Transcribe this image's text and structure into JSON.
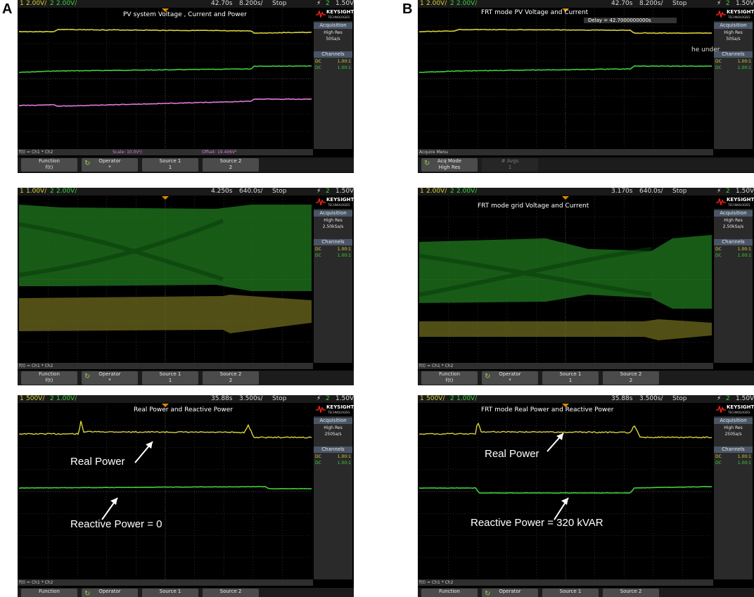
{
  "panel_letters": [
    "A",
    "B"
  ],
  "brand": {
    "name": "KEYSIGHT",
    "sub": "TECHNOLOGIES"
  },
  "acq_heading": "Acquisition",
  "channels_heading": "Channels",
  "scopes": {
    "a1": {
      "topbar": {
        "ch1": "1",
        "ch1_scale": "2.00V/",
        "ch2": "2",
        "ch2_scale": "2.00V/",
        "time": "42.70s",
        "timebase": "8.200s/",
        "run": "Stop",
        "trig_ch": "2",
        "trig_lvl": "1.50V"
      },
      "title": "PV system Voltage , Current and Power",
      "acq_mode": "High Res",
      "acq_rate": "50Sa/s",
      "channels": [
        {
          "coupling": "DC",
          "ratio": "1.00:1"
        },
        {
          "coupling": "DC",
          "ratio": "1.00:1"
        }
      ],
      "status": {
        "expr": "f(t) = Ch1 * Ch2",
        "scale": "Scale: 10.0V²/",
        "offset": "Offset: 19.406V²"
      },
      "softkeys": [
        {
          "label": "Function",
          "value": "f(t)"
        },
        {
          "label": "Operator",
          "value": "*"
        },
        {
          "label": "Source 1",
          "value": "1"
        },
        {
          "label": "Source 2",
          "value": "2"
        }
      ]
    },
    "b1": {
      "topbar": {
        "ch1": "1",
        "ch1_scale": "2.00V/",
        "ch2": "2",
        "ch2_scale": "2.00V/",
        "time": "42.70s",
        "timebase": "8.200s/",
        "run": "Stop",
        "trig_ch": "2",
        "trig_lvl": "1.50V"
      },
      "title": "FRT mode PV Voltage and Current",
      "delay": "Delay = 42.7000000000s",
      "overlay_fragment": "he under",
      "acq_mode": "High Res",
      "acq_rate": "50Sa/s",
      "channels": [
        {
          "coupling": "DC",
          "ratio": "1.00:1"
        },
        {
          "coupling": "DC",
          "ratio": "1.00:1"
        }
      ],
      "status": {
        "menu": "Acquire Menu"
      },
      "softkeys": [
        {
          "label": "Acq Mode",
          "value": "High Res"
        },
        {
          "label": "# Avgs",
          "value": "1"
        }
      ]
    },
    "a2": {
      "topbar": {
        "ch1": "1",
        "ch1_scale": "1.00V/",
        "ch2": "2",
        "ch2_scale": "2.00V/",
        "time": "4.250s",
        "timebase": "640.0s/",
        "run": "Stop",
        "trig_ch": "2",
        "trig_lvl": "1.50V"
      },
      "acq_mode": "High Res",
      "acq_rate": "2.50kSa/s",
      "channels": [
        {
          "coupling": "DC",
          "ratio": "1.00:1"
        },
        {
          "coupling": "DC",
          "ratio": "1.00:1"
        }
      ],
      "status": {
        "expr": "f(t) = Ch1 * Ch2"
      },
      "softkeys": [
        {
          "label": "Function",
          "value": "f(t)"
        },
        {
          "label": "Operator",
          "value": "*"
        },
        {
          "label": "Source 1",
          "value": "1"
        },
        {
          "label": "Source 2",
          "value": "2"
        }
      ]
    },
    "b2": {
      "topbar": {
        "ch1": "1",
        "ch1_scale": "2.00V/",
        "ch2": "2",
        "ch2_scale": "2.00V/",
        "time": "3.170s",
        "timebase": "640.0s/",
        "run": "Stop",
        "trig_ch": "2",
        "trig_lvl": "1.50V"
      },
      "title": "FRT mode grid Voltage and Current",
      "acq_mode": "High Res",
      "acq_rate": "2.50kSa/s",
      "channels": [
        {
          "coupling": "DC",
          "ratio": "1.00:1"
        },
        {
          "coupling": "DC",
          "ratio": "1.00:1"
        }
      ],
      "status": {
        "expr": "f(t) = Ch1 * Ch2"
      },
      "softkeys": [
        {
          "label": "Function",
          "value": "f(t)"
        },
        {
          "label": "Operator",
          "value": "*"
        },
        {
          "label": "Source 1",
          "value": "1"
        },
        {
          "label": "Source 2",
          "value": "2"
        }
      ]
    },
    "a3": {
      "topbar": {
        "ch1": "1",
        "ch1_scale": "500V/",
        "ch2": "2",
        "ch2_scale": "1.00V/",
        "time": "35.88s",
        "timebase": "3.500s/",
        "run": "Stop",
        "trig_ch": "2",
        "trig_lvl": "1.50V"
      },
      "title": "Real Power and Reactive Power",
      "acq_mode": "High Res",
      "acq_rate": "250Sa/s",
      "channels": [
        {
          "coupling": "DC",
          "ratio": "1.00:1"
        },
        {
          "coupling": "DC",
          "ratio": "1.00:1"
        }
      ],
      "annot_real": "Real Power",
      "annot_reactive": "Reactive Power = 0",
      "status": {
        "expr": "f(t) = Ch1 * Ch2"
      },
      "softkeys": [
        {
          "label": "Function",
          "value": ""
        },
        {
          "label": "Operator",
          "value": ""
        },
        {
          "label": "Source 1",
          "value": ""
        },
        {
          "label": "Source 2",
          "value": ""
        }
      ]
    },
    "b3": {
      "topbar": {
        "ch1": "1",
        "ch1_scale": "500V/",
        "ch2": "2",
        "ch2_scale": "1.00V/",
        "time": "35.88s",
        "timebase": "3.500s/",
        "run": "Stop",
        "trig_ch": "2",
        "trig_lvl": "1.50V"
      },
      "title": "FRT mode Real Power and Reactive Power",
      "acq_mode": "High Res",
      "acq_rate": "250Sa/s",
      "channels": [
        {
          "coupling": "DC",
          "ratio": "1.00:1"
        },
        {
          "coupling": "DC",
          "ratio": "1.00:1"
        }
      ],
      "annot_real": "Real Power",
      "annot_reactive": "Reactive Power = 320 kVAR",
      "status": {
        "expr": "f(t) = Ch1 * Ch2"
      },
      "softkeys": [
        {
          "label": "Function",
          "value": ""
        },
        {
          "label": "Operator",
          "value": ""
        },
        {
          "label": "Source 1",
          "value": ""
        },
        {
          "label": "Source 2",
          "value": ""
        }
      ]
    }
  },
  "colors": {
    "ch1": "#d8d23a",
    "ch2": "#3cd23c",
    "math": "#e07ad8",
    "grid": "#4a4a4a",
    "ch1_fill": "#6e6a1e",
    "ch2_fill": "#1f7a1f"
  }
}
